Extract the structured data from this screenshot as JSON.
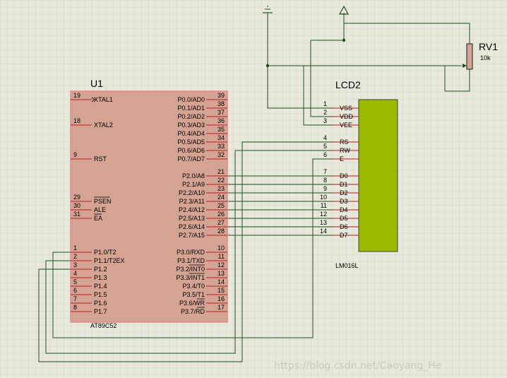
{
  "u1": {
    "ref": "U1",
    "part": "AT89C52",
    "left_pins": [
      {
        "num": "19",
        "name": "XTAL1",
        "clock": true
      },
      {
        "num": "18",
        "name": "XTAL2"
      },
      {
        "num": "9",
        "name": "RST"
      },
      {
        "num": "29",
        "name": "PSEN",
        "bar": true
      },
      {
        "num": "30",
        "name": "ALE"
      },
      {
        "num": "31",
        "name": "EA",
        "bar": true
      },
      {
        "num": "1",
        "name": "P1.0/T2"
      },
      {
        "num": "2",
        "name": "P1.1/T2EX"
      },
      {
        "num": "3",
        "name": "P1.2"
      },
      {
        "num": "4",
        "name": "P1.3"
      },
      {
        "num": "5",
        "name": "P1.4"
      },
      {
        "num": "6",
        "name": "P1.5"
      },
      {
        "num": "7",
        "name": "P1.6"
      },
      {
        "num": "8",
        "name": "P1.7"
      }
    ],
    "right_pins": [
      {
        "num": "39",
        "name": "P0.0/AD0"
      },
      {
        "num": "38",
        "name": "P0.1/AD1"
      },
      {
        "num": "37",
        "name": "P0.2/AD2"
      },
      {
        "num": "36",
        "name": "P0.3/AD3"
      },
      {
        "num": "35",
        "name": "P0.4/AD4"
      },
      {
        "num": "34",
        "name": "P0.5/AD5"
      },
      {
        "num": "33",
        "name": "P0.6/AD6"
      },
      {
        "num": "32",
        "name": "P0.7/AD7"
      },
      {
        "num": "21",
        "name": "P2.0/A8"
      },
      {
        "num": "22",
        "name": "P2.1/A9"
      },
      {
        "num": "23",
        "name": "P2.2/A10"
      },
      {
        "num": "24",
        "name": "P2.3/A11"
      },
      {
        "num": "25",
        "name": "P2.4/A12"
      },
      {
        "num": "26",
        "name": "P2.5/A13"
      },
      {
        "num": "27",
        "name": "P2.6/A14"
      },
      {
        "num": "28",
        "name": "P2.7/A15"
      },
      {
        "num": "10",
        "name": "P3.0/RXD"
      },
      {
        "num": "11",
        "name": "P3.1/TXD"
      },
      {
        "num": "12",
        "name": "P3.2/INT0",
        "barpart": "INT0"
      },
      {
        "num": "13",
        "name": "P3.3/INT1",
        "barpart": "INT1"
      },
      {
        "num": "14",
        "name": "P3.4/T0"
      },
      {
        "num": "15",
        "name": "P3.5/T1"
      },
      {
        "num": "16",
        "name": "P3.6/WR",
        "barpart": "WR"
      },
      {
        "num": "17",
        "name": "P3.7/RD",
        "barpart": "RD"
      }
    ]
  },
  "lcd": {
    "ref": "LCD2",
    "part": "LM016L",
    "pins": [
      {
        "num": "1",
        "name": "VSS"
      },
      {
        "num": "2",
        "name": "VDD"
      },
      {
        "num": "3",
        "name": "VEE"
      },
      {
        "num": "4",
        "name": "RS"
      },
      {
        "num": "5",
        "name": "RW"
      },
      {
        "num": "6",
        "name": "E"
      },
      {
        "num": "7",
        "name": "D0"
      },
      {
        "num": "8",
        "name": "D1"
      },
      {
        "num": "9",
        "name": "D2"
      },
      {
        "num": "10",
        "name": "D3"
      },
      {
        "num": "11",
        "name": "D4"
      },
      {
        "num": "12",
        "name": "D5"
      },
      {
        "num": "13",
        "name": "D6"
      },
      {
        "num": "14",
        "name": "D7"
      }
    ]
  },
  "rv": {
    "ref": "RV1",
    "value": "10k"
  },
  "watermark": "https://blog.csdn.net/Caoyang_He",
  "colors": {
    "background": "#e8e8dc",
    "grid": "#d4d4c4",
    "chip_fill": "#d4a393",
    "chip_border": "#e48c8c",
    "wire": "#1e4a1e",
    "pin": "#b02020",
    "lcd_screen": "#9aba00"
  }
}
